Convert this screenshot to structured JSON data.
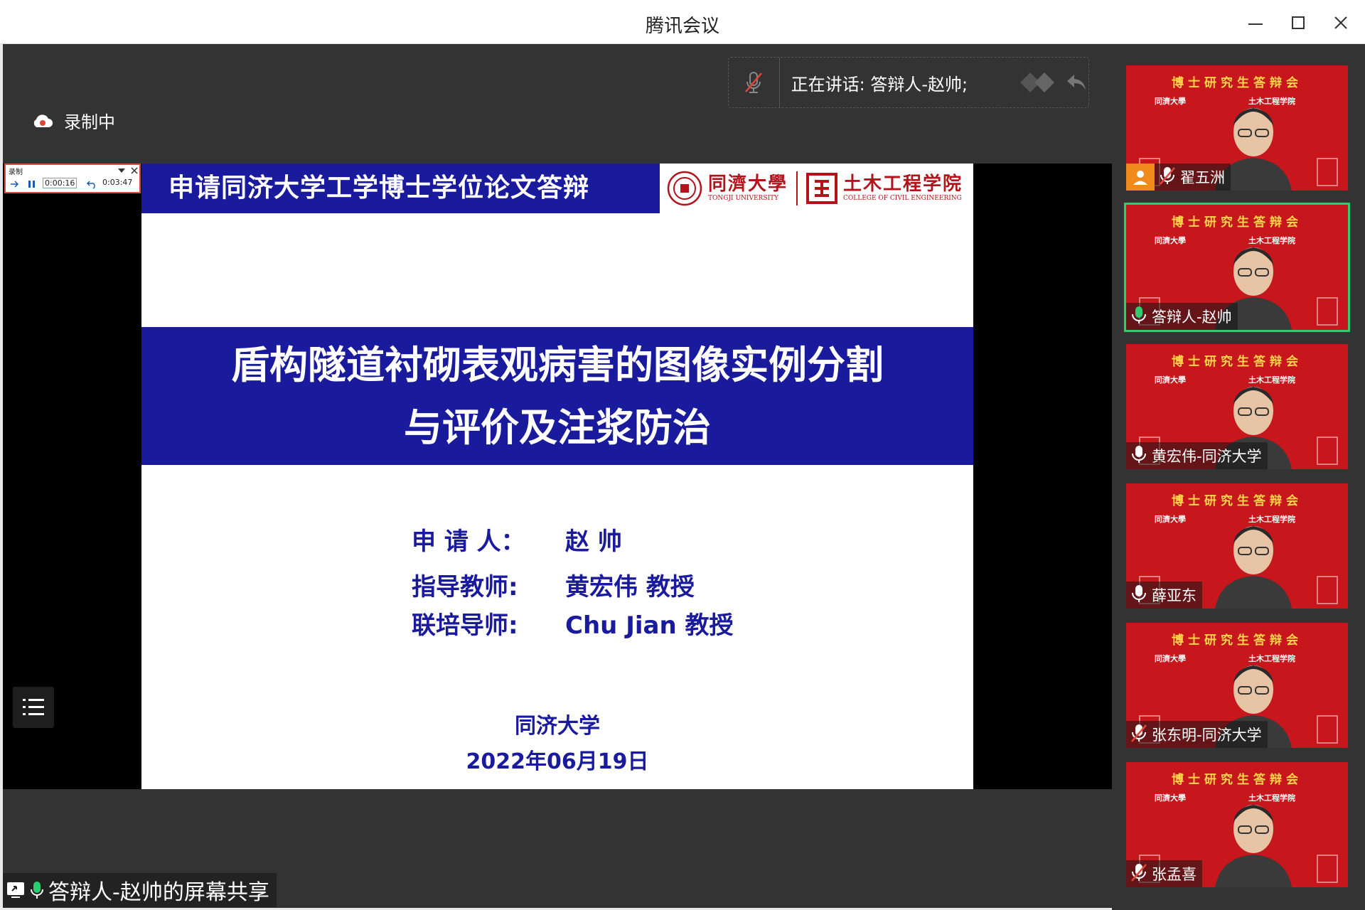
{
  "window": {
    "title": "腾讯会议"
  },
  "toolbar": {
    "recording_label": "录制中",
    "speaking_text": "正在讲话: 答辩人-赵帅;"
  },
  "recorder": {
    "title": "录制",
    "elapsed": "0:00:16",
    "total": "0:03:47"
  },
  "slide": {
    "header": "申请同济大学工学博士学位论文答辩",
    "logo_tongji_cn": "同濟大學",
    "logo_tongji_en": "TONGJI UNIVERSITY",
    "logo_civil_cn": "土木工程学院",
    "logo_civil_en": "COLLEGE OF CIVIL ENGINEERING",
    "title_line1": "盾构隧道衬砌表观病害的图像实例分割",
    "title_line2": "与评价及注浆防治",
    "applicant_label": "申 请 人：",
    "applicant_value": "赵 帅",
    "advisor_label": "指导教师:",
    "advisor_value": "黄宏伟 教授",
    "coadvisor_label": "联培导师:",
    "coadvisor_value": "Chu Jian 教授",
    "university": "同济大学",
    "date": "2022年06月19日"
  },
  "share": {
    "label": "答辩人-赵帅的屏幕共享"
  },
  "tile_banner": "博士研究生答辩会",
  "tile_logo_left": "同濟大學",
  "tile_logo_right": "土木工程学院",
  "participants": [
    {
      "name": "翟五洲",
      "mic": "muted"
    },
    {
      "name": "答辩人-赵帅",
      "mic": "active"
    },
    {
      "name": "黄宏伟-同济大学",
      "mic": "on"
    },
    {
      "name": "薛亚东",
      "mic": "on"
    },
    {
      "name": "张东明-同济大学",
      "mic": "muted"
    },
    {
      "name": "张孟喜",
      "mic": "muted"
    }
  ],
  "colors": {
    "slide_blue": "#1a1a9c",
    "tile_red": "#c8161d",
    "banner_gold": "#ffd84a",
    "active_green": "#2ecc71"
  }
}
